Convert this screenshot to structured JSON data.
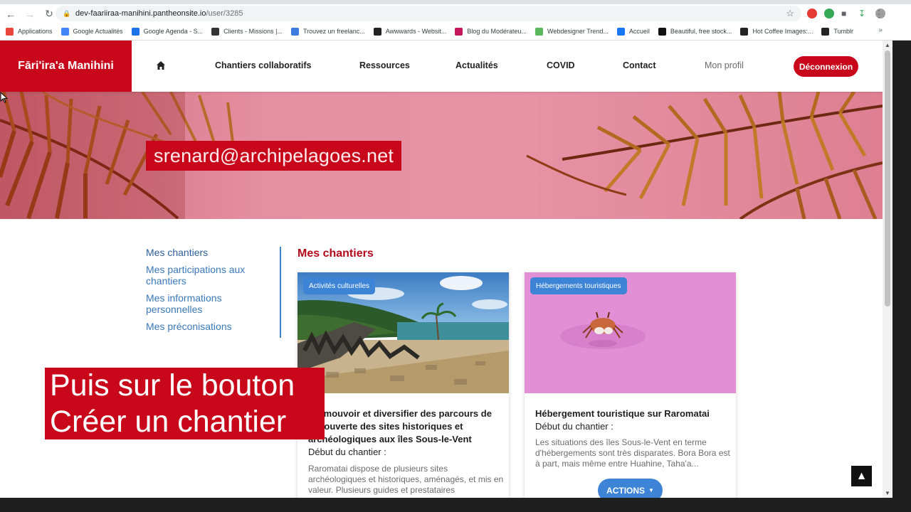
{
  "browser": {
    "url_host": "dev-faariiraa-manihini.pantheonsite.io",
    "url_path": "/user/3285",
    "bookmarks": [
      {
        "label": "Applications",
        "color": "#e8453c"
      },
      {
        "label": "Google Actualités",
        "color": "#4285f4"
      },
      {
        "label": "Google Agenda - S...",
        "color": "#1a73e8"
      },
      {
        "label": "Clients - Missions |...",
        "color": "#333333"
      },
      {
        "label": "Trouvez un freelanc...",
        "color": "#3c7be0"
      },
      {
        "label": "Awwwards - Websit...",
        "color": "#222222"
      },
      {
        "label": "Blog du Modérateu...",
        "color": "#c2185b"
      },
      {
        "label": "Webdesigner Trend...",
        "color": "#5cb85c"
      },
      {
        "label": "Accueil",
        "color": "#1877f2"
      },
      {
        "label": "Beautiful, free stock...",
        "color": "#111111"
      },
      {
        "label": "Hot Coffee Images:...",
        "color": "#222222"
      },
      {
        "label": "Tumblr",
        "color": "#222222"
      }
    ],
    "bookmarks_more": "»"
  },
  "header": {
    "brand": "Fāri'ira'a Manihini",
    "nav": {
      "chantiers": "Chantiers collaboratifs",
      "ressources": "Ressources",
      "actualites": "Actualités",
      "covid": "COVID",
      "contact": "Contact",
      "profil": "Mon profil"
    },
    "logout": "Déconnexion"
  },
  "hero": {
    "email": "srenard@archipelagoes.net"
  },
  "sidebar": {
    "items": [
      {
        "label": "Mes chantiers"
      },
      {
        "label": "Mes participations aux chantiers"
      },
      {
        "label": "Mes informations personnelles"
      },
      {
        "label": "Mes préconisations"
      }
    ]
  },
  "main": {
    "title": "Mes chantiers",
    "cards": [
      {
        "badge": "Activités culturelles",
        "title": "Promouvoir et diversifier des parcours de découverte des sites historiques et archéologiques aux îles Sous-le-Vent",
        "date_label": "Début du chantier :",
        "text": "Raromatai dispose de plusieurs sites archéologiques et historiques, aménagés, et mis en valeur. Plusieurs guides et prestataires"
      },
      {
        "badge": "Hébergements touristiques",
        "title": "Hébergement touristique sur Raromatai",
        "date_label": "Début du chantier :",
        "text": "Les situations des îles Sous-le-Vent en terme d'hébergements sont très disparates. Bora Bora est à part, mais même entre Huahine, Taha'a...",
        "actions": "ACTIONS"
      }
    ]
  },
  "caption": {
    "line1": "Puis sur le bouton",
    "line2": "Créer un chantier"
  },
  "colors": {
    "brand_red": "#c8081a",
    "accent_blue": "#3d84d6"
  }
}
